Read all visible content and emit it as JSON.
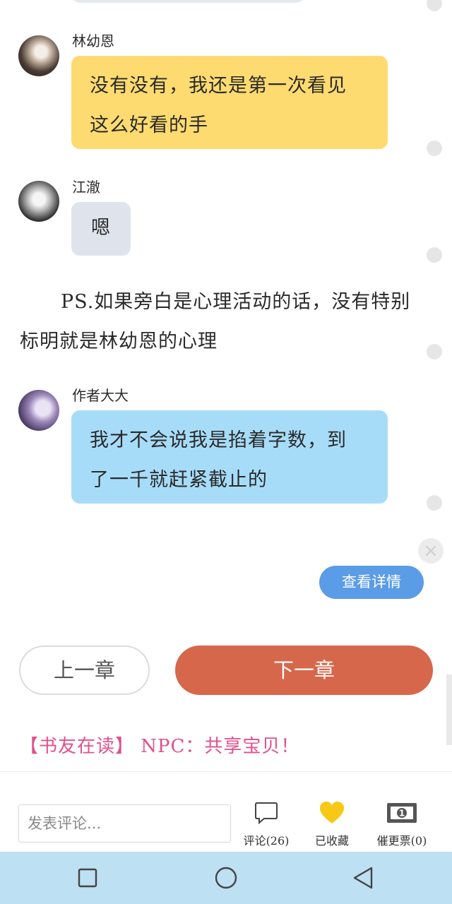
{
  "chat": [
    {
      "speaker": "林幼恩",
      "lines": [
        "没有没有，我还是第一次看见",
        "这么好看的手"
      ],
      "color": "#fedb70"
    },
    {
      "speaker": "江澈",
      "lines": [
        "嗯"
      ],
      "color": "#dfe4ec"
    },
    {
      "speaker": "作者大大",
      "lines": [
        "我才不会说我是掐着字数，到",
        "了一千就赶紧截止的"
      ],
      "color": "#a7dcf9"
    }
  ],
  "narration": "PS.如果旁白是心理活动的话，没有特别标明就是林幼恩的心理",
  "detail_button": "查看详情",
  "close_icon": "×",
  "chapter_nav": {
    "prev": "上一章",
    "next": "下一章"
  },
  "reading_now": "【书友在读】 NPC：共享宝贝！",
  "toolbar": {
    "comment_placeholder": "发表评论...",
    "comments_label": "评论(26)",
    "favorited_label": "已收藏",
    "vote_label": "催更票(0)"
  },
  "colors": {
    "accent_next": "#d6674b",
    "detail_blue": "#5b9ce6",
    "reading_pink": "#e0508c",
    "navbar": "#bde0f3"
  }
}
